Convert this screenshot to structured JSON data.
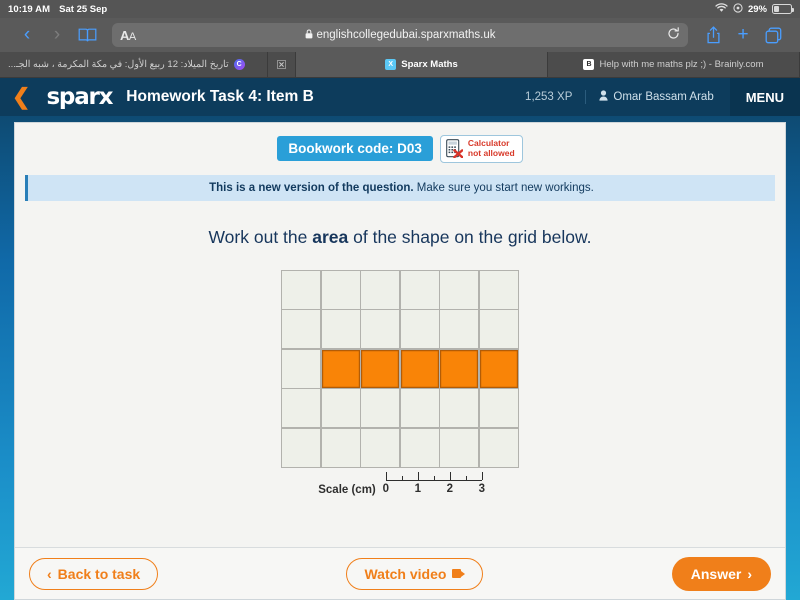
{
  "status_bar": {
    "time": "10:19 AM",
    "date": "Sat 25 Sep",
    "battery_percent": "29%",
    "wifi_icon": "wifi-icon",
    "location_icon": "location-icon",
    "battery_icon": "battery-icon"
  },
  "browser": {
    "back_icon": "back-chevron-icon",
    "forward_icon": "forward-chevron-icon",
    "bookmarks_icon": "book-icon",
    "text_size_label": "AA",
    "lock_icon": "lock-icon",
    "url": "englishcollegedubai.sparxmaths.uk",
    "reload_icon": "reload-icon",
    "share_icon": "share-icon",
    "new_tab_icon": "plus-icon",
    "tabs_icon": "tabs-icon",
    "tabs": [
      {
        "title": "تاريخ الميلاد: 12 ربيع الأول: في مكة المكرمة ، شبه الجـ...",
        "favicon": "c-favicon",
        "active": false
      },
      {
        "title": "Sparx Maths",
        "favicon": "sparx-favicon",
        "active": true
      },
      {
        "title": "Help with me maths plz ;) - Brainly.com",
        "favicon": "brainly-favicon",
        "active": false
      }
    ],
    "close_tab_icon": "close-icon"
  },
  "app_header": {
    "back_icon": "back-arrow-icon",
    "logo": "sparx",
    "task_title": "Homework Task 4: Item B",
    "xp": "1,253 XP",
    "user_icon": "person-icon",
    "user_name": "Omar Bassam Arab",
    "menu_label": "MENU"
  },
  "question_card": {
    "bookwork_code": "Bookwork code: D03",
    "calculator_icon": "calculator-icon",
    "calculator_line1": "Calculator",
    "calculator_line2": "not allowed",
    "notice_bold": "This is a new version of the question.",
    "notice_rest": " Make sure you start new workings.",
    "question_pre": "Work out the ",
    "question_bold": "area",
    "question_post": " of the shape on the grid below."
  },
  "figure": {
    "grid_columns": 6,
    "grid_rows": 5,
    "shape_cells": [
      [
        2,
        1
      ],
      [
        2,
        2
      ],
      [
        2,
        3
      ],
      [
        2,
        4
      ],
      [
        2,
        5
      ]
    ],
    "shape_color": "#f98407",
    "shape_border_color": "#b35c06",
    "grid_cell_color": "#eef0e9",
    "grid_line_color": "#b2b2ad",
    "scale_label": "Scale (cm)",
    "scale_ticks": [
      "0",
      "1",
      "2",
      "3"
    ],
    "scale_minor_ticks": 3
  },
  "footer": {
    "back_chevron": "‹",
    "back_label": "Back to task",
    "watch_label": "Watch video",
    "video_icon": "video-camera-icon",
    "answer_label": "Answer",
    "answer_chevron": "›",
    "accent_color": "#f07f1a"
  }
}
